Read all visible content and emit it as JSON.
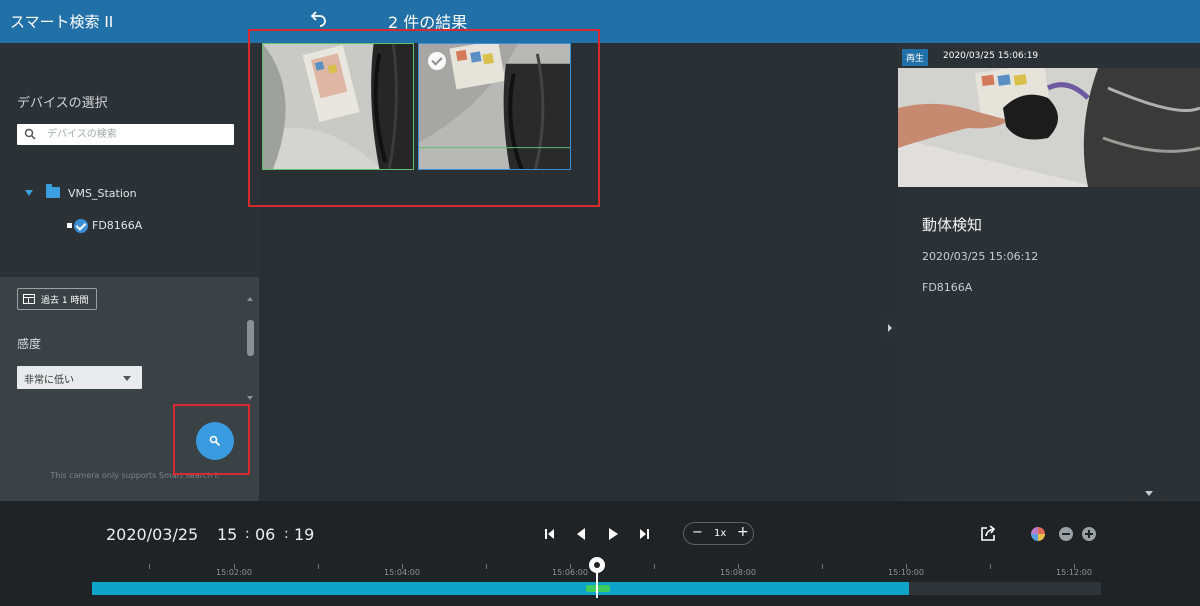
{
  "header": {
    "app_title": "スマート検索 II",
    "results_title": "2 件の結果"
  },
  "devices": {
    "title": "デバイスの選択",
    "search_placeholder": "デバイスの検索",
    "tree": {
      "station": "VMS_Station",
      "camera": "FD8166A"
    }
  },
  "filters": {
    "time_range_label": "過去 1 時間",
    "sensitivity_label": "感度",
    "sensitivity_value": "非常に低い",
    "note": "This camera only supports Smart search I."
  },
  "preview": {
    "badge": "再生",
    "timestamp": "2020/03/25 15:06:19",
    "event_title": "動体検知",
    "event_time": "2020/03/25 15:06:12",
    "event_camera": "FD8166A"
  },
  "playback": {
    "date": "2020/03/25",
    "hour": "15",
    "minute": "06",
    "second": "19",
    "speed": "1x",
    "speed_minus": "−",
    "speed_plus": "+"
  },
  "timeline": {
    "labels": [
      "15:02:00",
      "15:04:00",
      "15:06:00",
      "15:08:00",
      "15:10:00",
      "15:12:00"
    ],
    "recorded_fraction": 0.81,
    "playhead_fraction": 0.5
  },
  "colors": {
    "accent": "#2270a8",
    "recording": "#0ea3c9",
    "motion_event": "#3ecb60",
    "highlight": "#d62a2f"
  }
}
